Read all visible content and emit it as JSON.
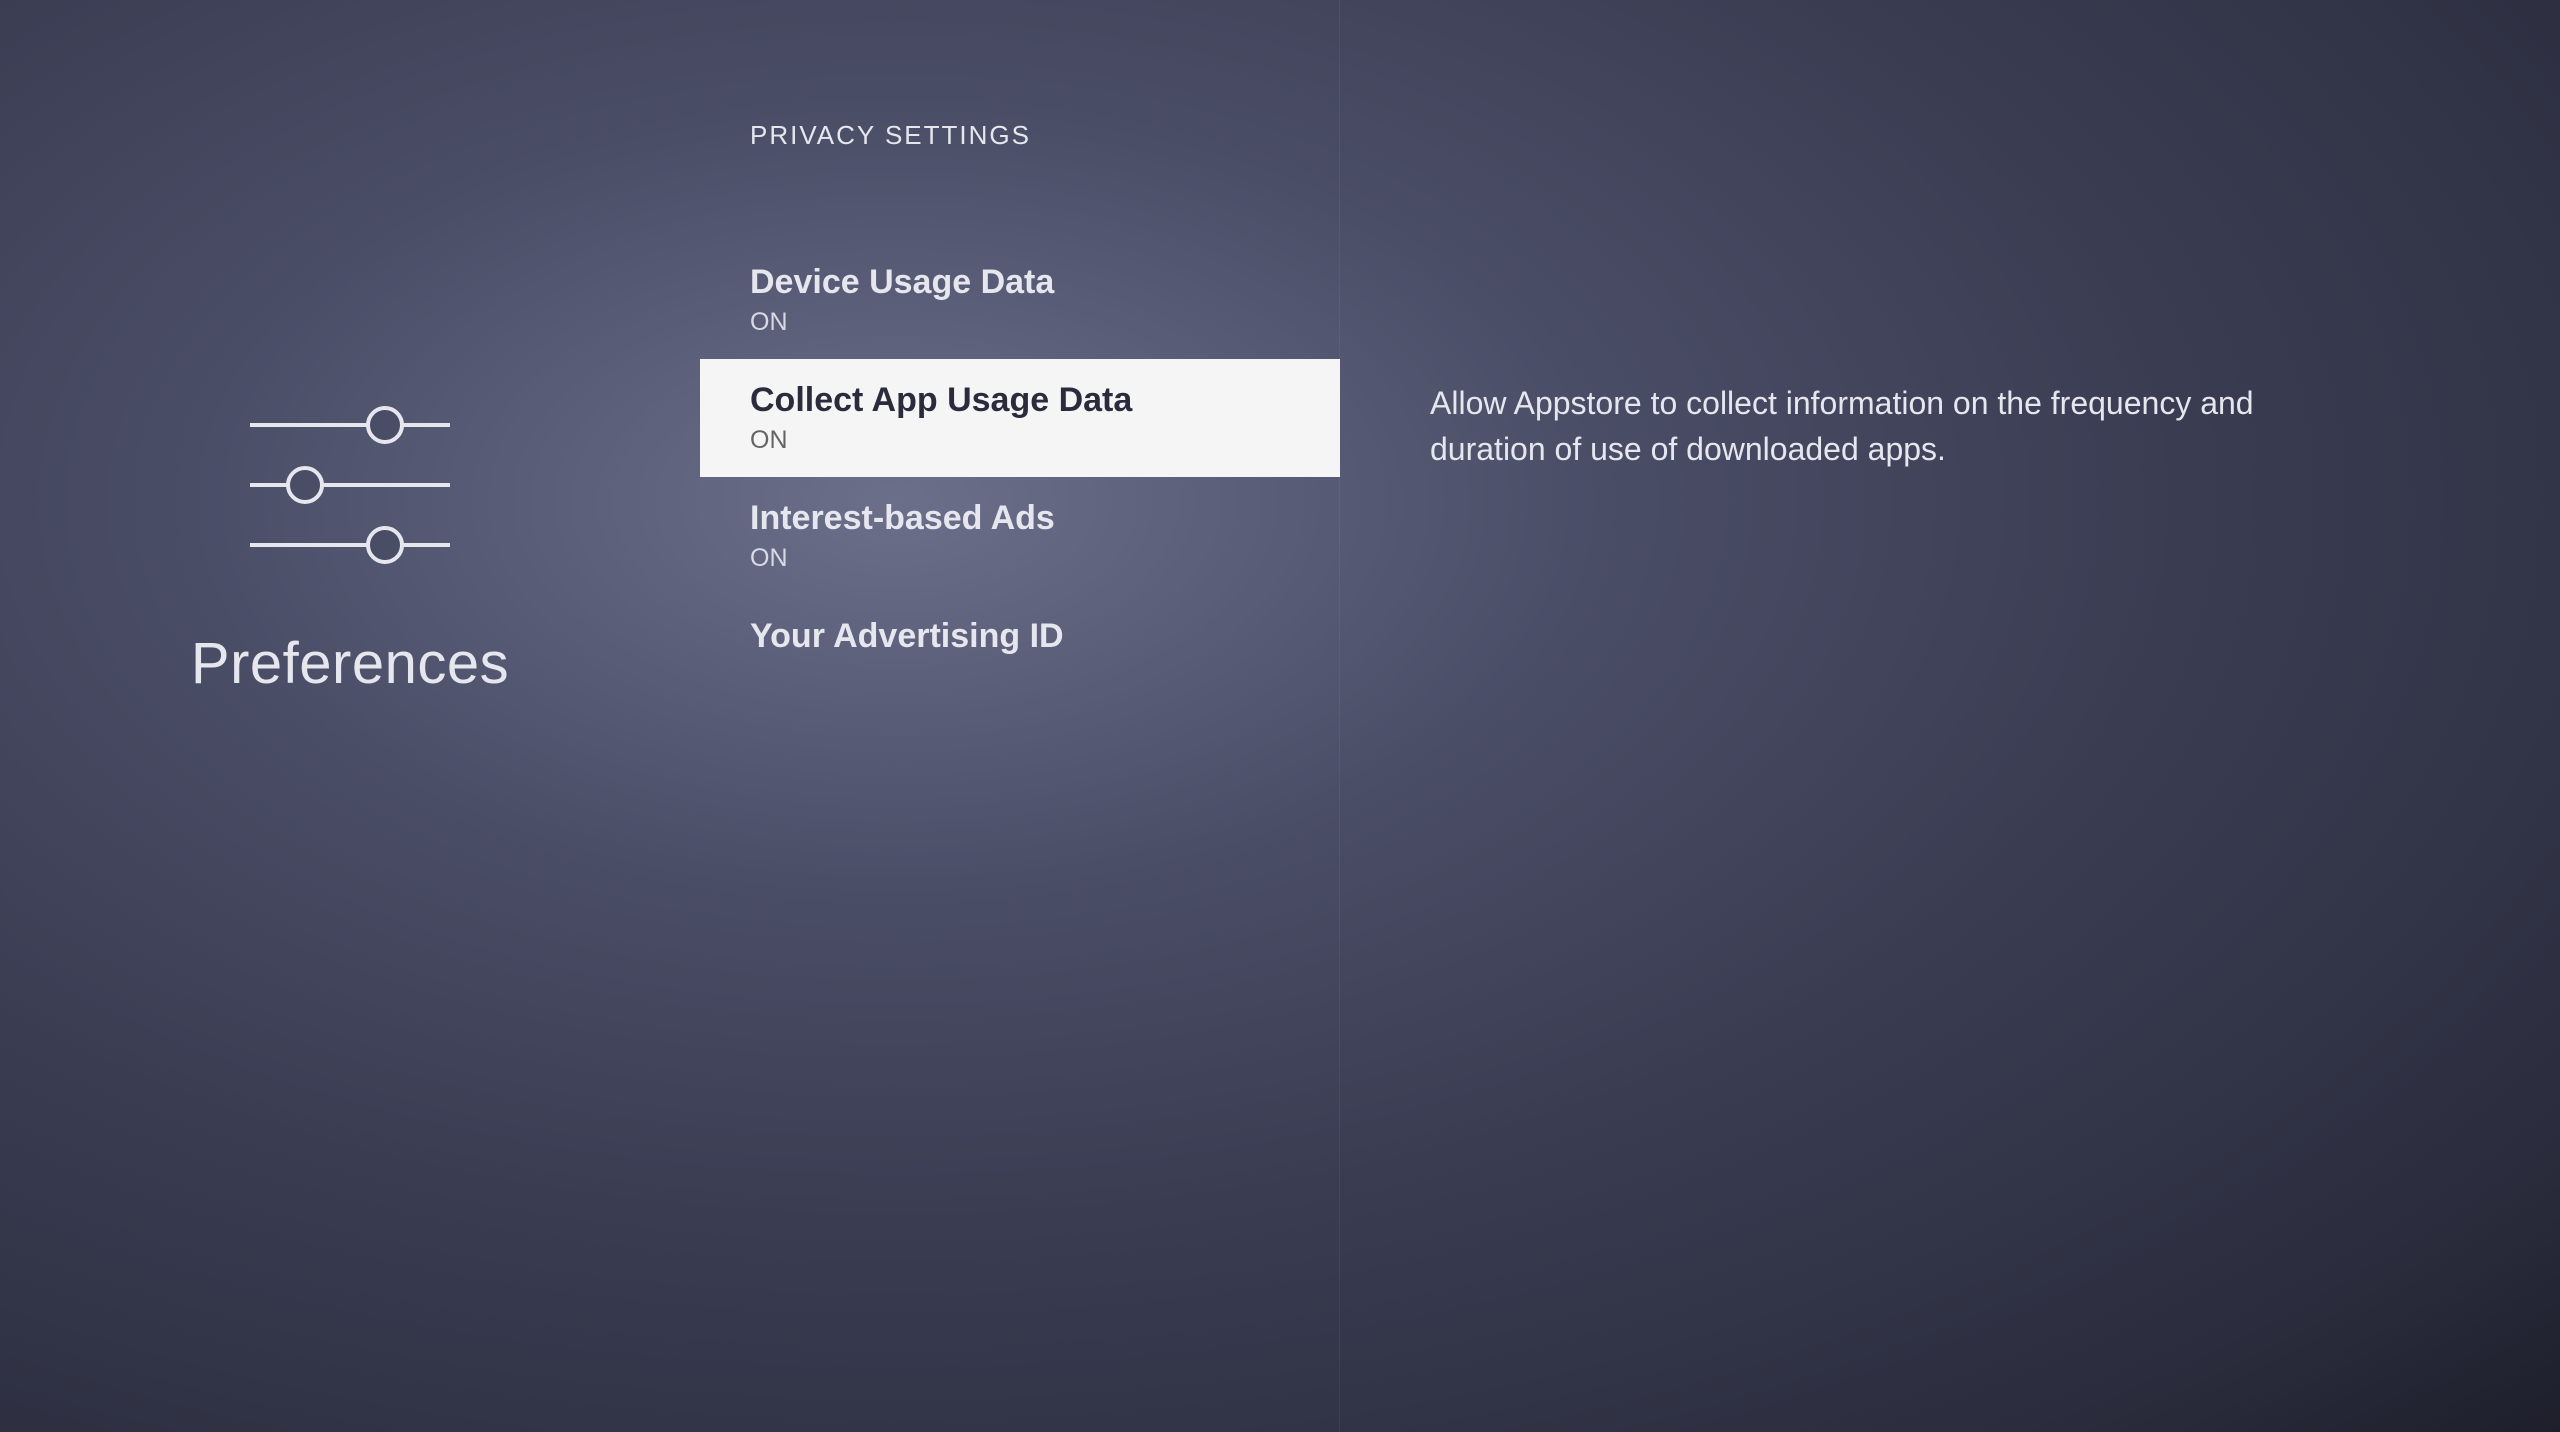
{
  "left": {
    "title": "Preferences",
    "icon": "sliders-icon"
  },
  "section_header": "PRIVACY SETTINGS",
  "menu": {
    "items": [
      {
        "title": "Device Usage Data",
        "status": "ON",
        "selected": false
      },
      {
        "title": "Collect App Usage Data",
        "status": "ON",
        "selected": true
      },
      {
        "title": "Interest-based Ads",
        "status": "ON",
        "selected": false
      },
      {
        "title": "Your Advertising ID",
        "status": "",
        "selected": false
      }
    ]
  },
  "description": "Allow Appstore to collect information on the frequency and duration of use of downloaded apps.",
  "colors": {
    "text_light": "#e6e7ee",
    "selected_bg": "#f5f5f5",
    "selected_text": "#2a2c3d"
  }
}
